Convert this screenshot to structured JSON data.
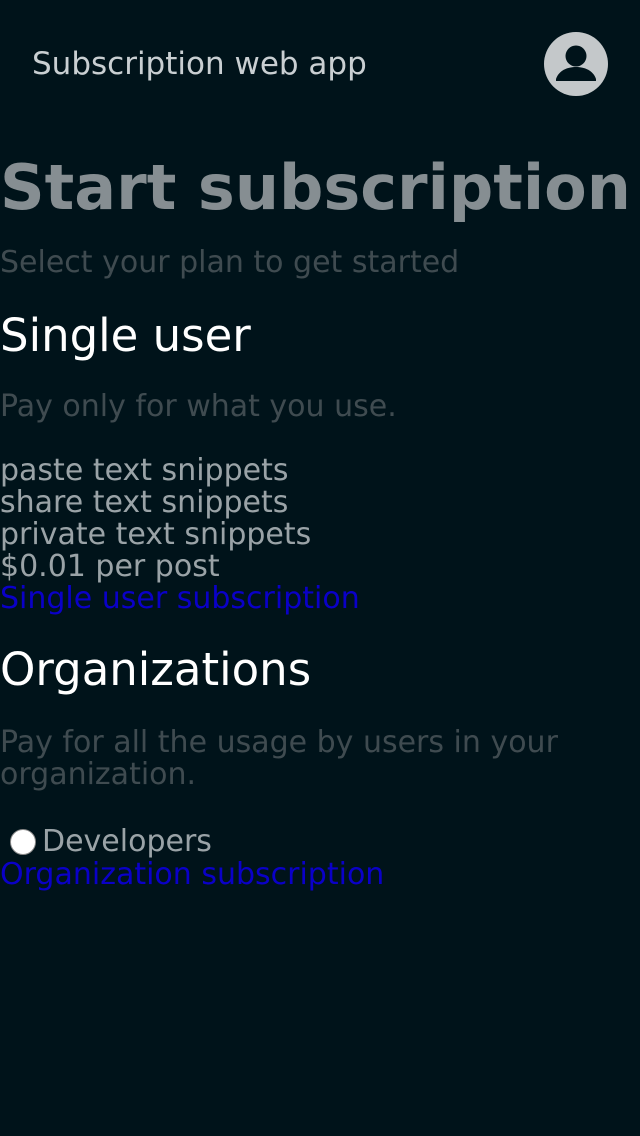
{
  "header": {
    "app_title": "Subscription web app",
    "account_icon": "account-circle-icon"
  },
  "page": {
    "title": "Start subscription",
    "subtitle": "Select your plan to get started"
  },
  "plans": {
    "single": {
      "heading": "Single user",
      "description": "Pay only for what you use.",
      "features": [
        "paste text snippets",
        "share text snippets",
        "private text snippets",
        "$0.01 per post"
      ],
      "link_label": "Single user subscription"
    },
    "organizations": {
      "heading": "Organizations",
      "description": "Pay for all the usage by users in your organization.",
      "option_label": "Developers",
      "option_selected": false,
      "link_label": "Organization subscription"
    }
  },
  "colors": {
    "background": "#00131a",
    "link": "#0a00c8",
    "heading": "#ffffff",
    "muted_text": "#3f4b50"
  }
}
